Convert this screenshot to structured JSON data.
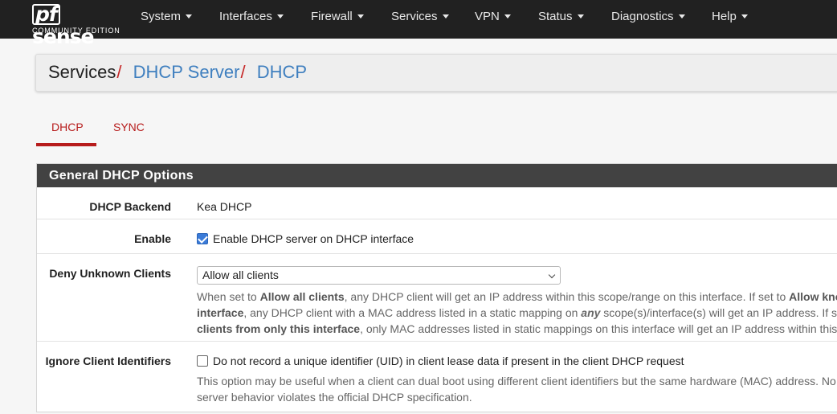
{
  "logo": {
    "brand_pf": "pf",
    "brand_rest": "sense",
    "edition": "COMMUNITY EDITION"
  },
  "nav": {
    "system": "System",
    "interfaces": "Interfaces",
    "firewall": "Firewall",
    "services": "Services",
    "vpn": "VPN",
    "status": "Status",
    "diagnostics": "Diagnostics",
    "help": "Help"
  },
  "breadcrumb": {
    "root": "Services",
    "sep": "/",
    "level1": "DHCP Server",
    "level2": "DHCP"
  },
  "tabs": {
    "dhcp": "DHCP",
    "sync": "SYNC"
  },
  "panel": {
    "title": "General DHCP Options",
    "backend": {
      "label": "DHCP Backend",
      "value": "Kea DHCP"
    },
    "enable": {
      "label": "Enable",
      "text": "Enable DHCP server on DHCP interface",
      "checked": true
    },
    "deny": {
      "label": "Deny Unknown Clients",
      "selected": "Allow all clients",
      "help1_pre": "When set to ",
      "help1_b1": "Allow all clients",
      "help1_mid": ", any DHCP client will get an IP address within this scope/range on this interface. If set to ",
      "help1_b2": "Allow know",
      "help2_b1": "interface",
      "help2_mid": ", any DHCP client with a MAC address listed in a static mapping on ",
      "help2_i": "any",
      "help2_post": " scope(s)/interface(s) will get an IP address. If se",
      "help3_b1": "clients from only this interface",
      "help3_post": ", only MAC addresses listed in static mappings on this interface will get an IP address within this s"
    },
    "ignore": {
      "label": "Ignore Client Identifiers",
      "text": "Do not record a unique identifier (UID) in client lease data if present in the client DHCP request",
      "checked": false,
      "help1": "This option may be useful when a client can dual boot using different client identifiers but the same hardware (MAC) address. No",
      "help2": "server behavior violates the official DHCP specification."
    }
  },
  "colors": {
    "navbar": "#212121",
    "accent_red": "#b71c1c",
    "link_blue": "#3f7fbf",
    "panel_head": "#424242",
    "checkbox": "#3b7bd8"
  }
}
